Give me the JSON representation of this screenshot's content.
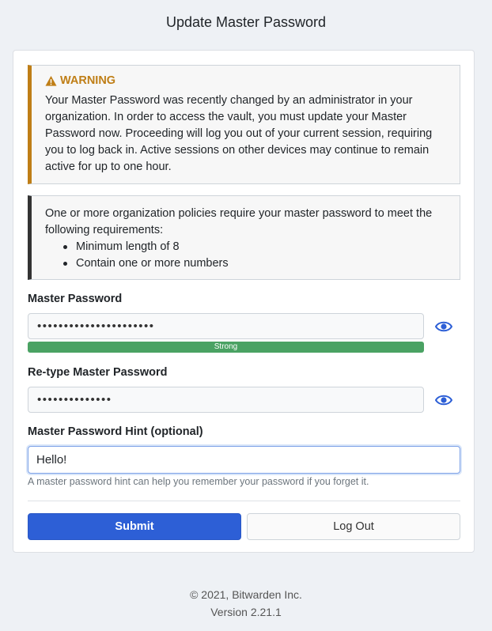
{
  "page": {
    "title": "Update Master Password"
  },
  "warning": {
    "title": "WARNING",
    "text": "Your Master Password was recently changed by an administrator in your organization. In order to access the vault, you must update your Master Password now. Proceeding will log you out of your current session, requiring you to log back in. Active sessions on other devices may continue to remain active for up to one hour."
  },
  "policy": {
    "text": "One or more organization policies require your master password to meet the following requirements:",
    "requirements": [
      "Minimum length of 8",
      "Contain one or more numbers"
    ]
  },
  "form": {
    "master_password_label": "Master Password",
    "master_password_masked": "••••••••••••••••••••••",
    "strength_label": "Strong",
    "strength_fraction": 1.0,
    "retype_label": "Re-type Master Password",
    "retype_masked": "••••••••••••••",
    "hint_label": "Master Password Hint (optional)",
    "hint_value": "Hello!",
    "hint_help": "A master password hint can help you remember your password if you forget it."
  },
  "actions": {
    "submit_label": "Submit",
    "logout_label": "Log Out"
  },
  "footer": {
    "copyright": "© 2021, Bitwarden Inc.",
    "version": "Version 2.21.1"
  },
  "icons": {
    "warning": "warning-triangle-icon",
    "eye": "eye-icon"
  },
  "colors": {
    "primary": "#2d5fd6",
    "warning": "#bf7e16",
    "success": "#4aa263"
  }
}
